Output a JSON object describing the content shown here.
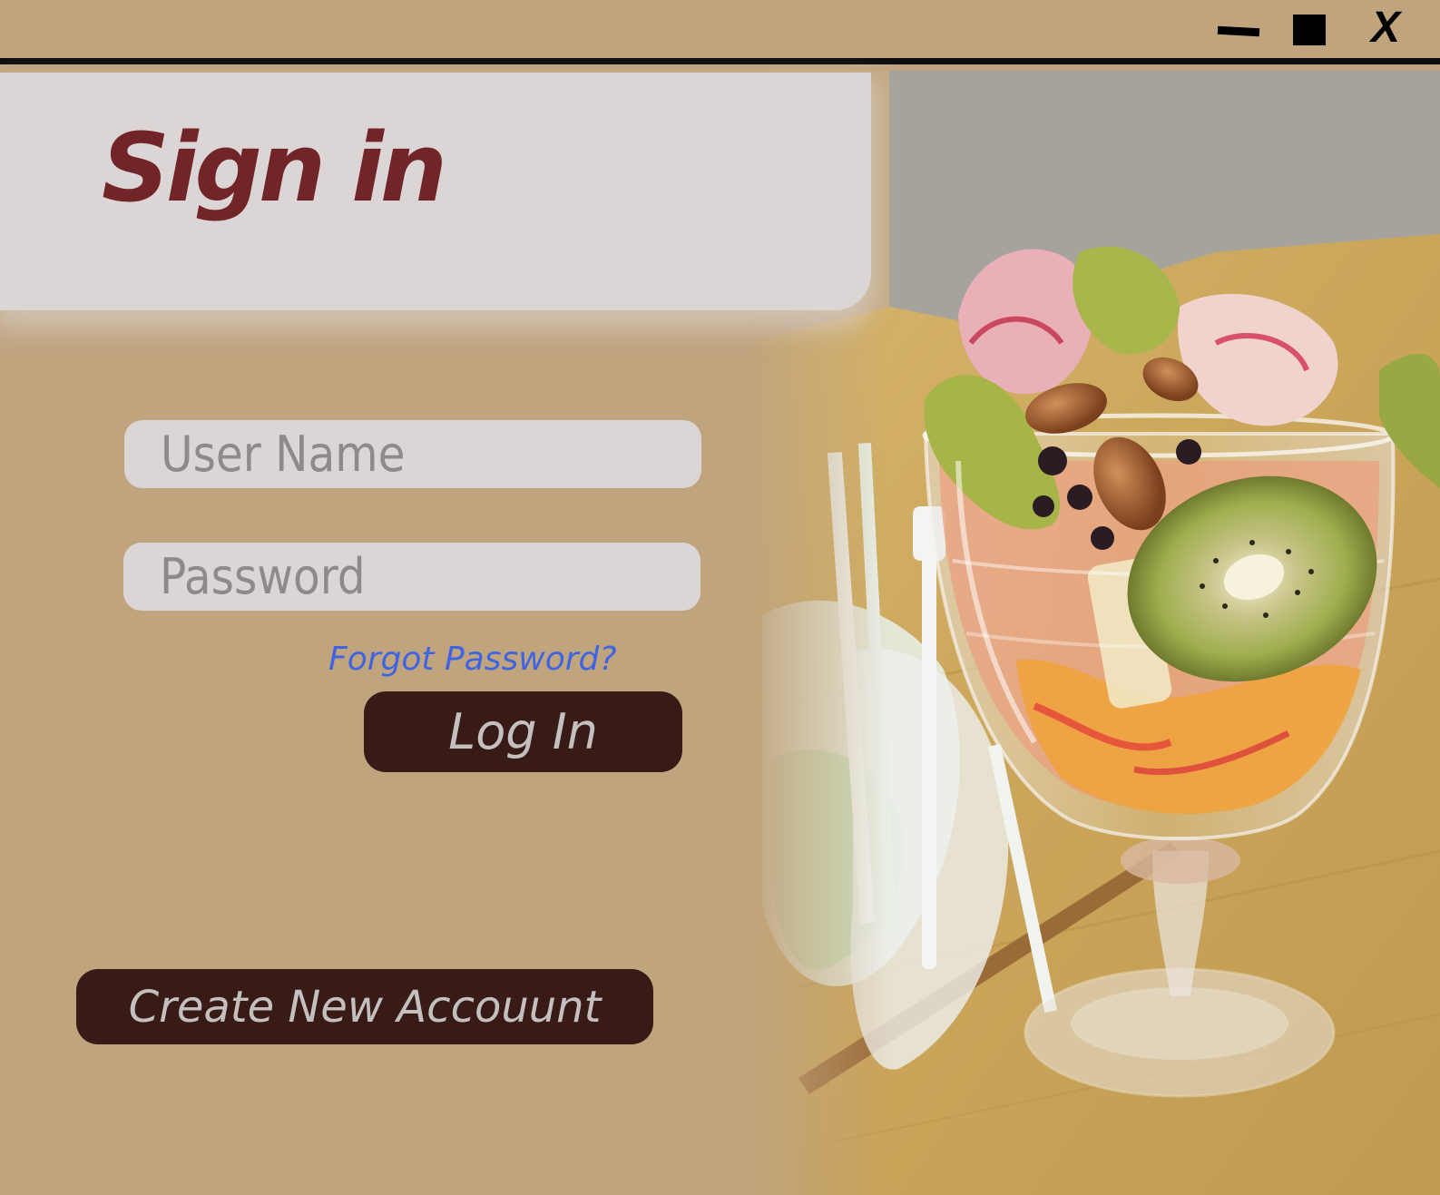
{
  "window": {
    "minimize_icon": "minimize-icon",
    "maximize_icon": "maximize-icon",
    "close_label": "X"
  },
  "header": {
    "title": "Sign in"
  },
  "form": {
    "username": {
      "placeholder": "User Name",
      "value": ""
    },
    "password": {
      "placeholder": "Password",
      "value": ""
    },
    "forgot_password_label": "Forgot Password?",
    "login_label": "Log In",
    "create_account_label": "Create New Accouunt"
  },
  "colors": {
    "background": "#c0a47e",
    "panel": "#dcd5d5",
    "title": "#722529",
    "button": "#381a17",
    "button_text": "#c4c0c0",
    "link": "#3e64e3",
    "placeholder": "#8f8a8a"
  }
}
